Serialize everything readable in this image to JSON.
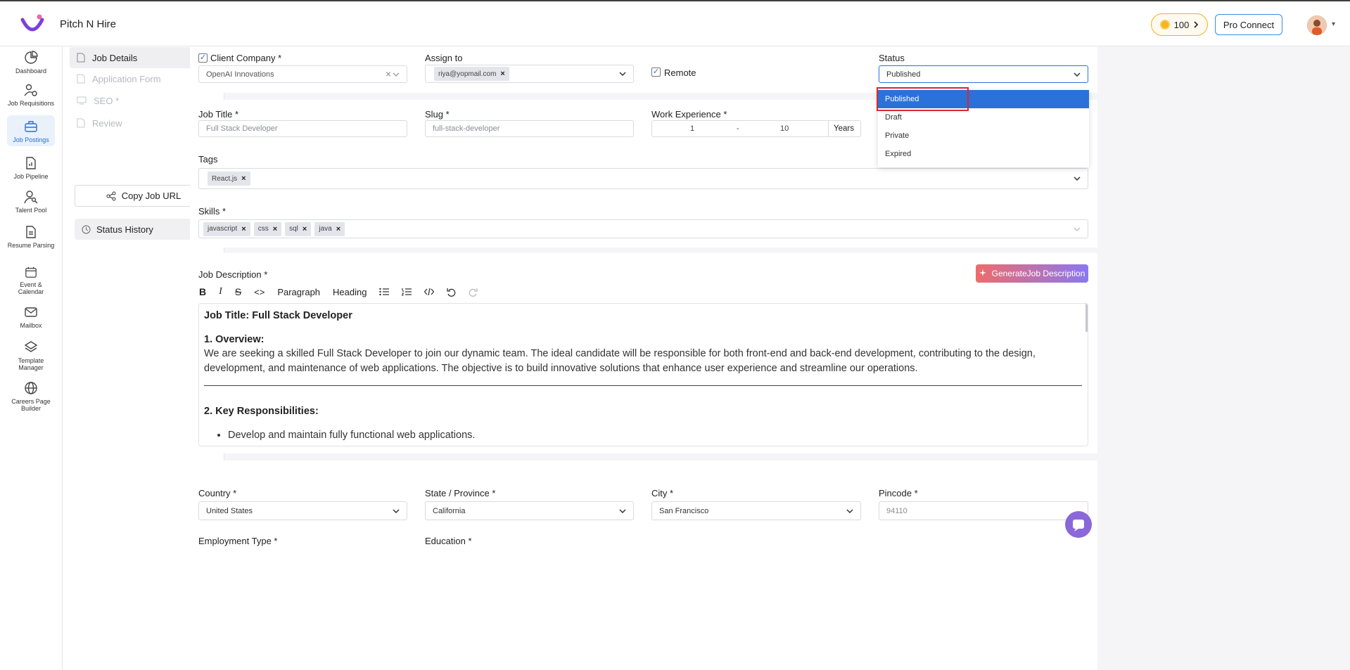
{
  "app": {
    "title": "Pitch N Hire",
    "coins": "100",
    "pro_connect": "Pro Connect"
  },
  "sidenav": [
    {
      "name": "dashboard",
      "label": "Dashboard"
    },
    {
      "name": "job-requisitions",
      "label": "Job Requisitions"
    },
    {
      "name": "job-postings",
      "label": "Job Postings",
      "active": true
    },
    {
      "name": "job-pipeline",
      "label": "Job Pipeline"
    },
    {
      "name": "talent-pool",
      "label": "Talent Pool"
    },
    {
      "name": "resume-parsing",
      "label": "Resume Parsing"
    },
    {
      "name": "event-calendar",
      "label": "Event & Calendar"
    },
    {
      "name": "mailbox",
      "label": "Mailbox"
    },
    {
      "name": "template-manager",
      "label": "Template Manager"
    },
    {
      "name": "careers-page-builder",
      "label": "Careers Page Builder"
    }
  ],
  "subnav": {
    "items": [
      {
        "label": "Job Details",
        "state": "active"
      },
      {
        "label": "Application Form",
        "state": "disabled"
      },
      {
        "label": "SEO *",
        "state": "disabled"
      },
      {
        "label": "Review",
        "state": "disabled"
      }
    ],
    "copy_url": "Copy Job URL",
    "status_history": "Status History"
  },
  "form": {
    "client_company_label": "Client Company",
    "client_company_value": "OpenAI Innovations",
    "assign_to_label": "Assign to",
    "assign_to_chip": "riya@yopmail.com",
    "remote_label": "Remote",
    "status_label": "Status",
    "status_value": "Published",
    "status_options": [
      "Published",
      "Draft",
      "Private",
      "Expired"
    ],
    "job_title_label": "Job Title",
    "job_title_value": "Full Stack Developer",
    "slug_label": "Slug",
    "slug_value": "full-stack-developer",
    "work_exp_label": "Work Experience",
    "work_exp_min": "1",
    "work_exp_sep": "-",
    "work_exp_max": "10",
    "work_exp_unit": "Years",
    "tags_label": "Tags",
    "tags": [
      "React.js"
    ],
    "skills_label": "Skills",
    "skills": [
      "javascript",
      "css",
      "sql",
      "java"
    ],
    "job_desc_label": "Job Description",
    "generate_btn": "GenerateJob Description",
    "toolbar": {
      "paragraph": "Paragraph",
      "heading": "Heading"
    },
    "editor": {
      "title": "Job Title: Full Stack Developer",
      "overview_heading": "1. Overview:",
      "overview_text": "We are seeking a skilled Full Stack Developer to join our dynamic team. The ideal candidate will be responsible for both front-end and back-end development, contributing to the design, development, and maintenance of web applications. The objective is to build innovative solutions that enhance user experience and streamline our operations.",
      "resp_heading": "2. Key Responsibilities:",
      "resp_item_1": "Develop and maintain fully functional web applications."
    },
    "country_label": "Country",
    "country_value": "United States",
    "state_label": "State / Province",
    "state_value": "California",
    "city_label": "City",
    "city_value": "San Francisco",
    "pincode_label": "Pincode",
    "pincode_value": "94110",
    "employment_label": "Employment Type",
    "education_label": "Education"
  }
}
